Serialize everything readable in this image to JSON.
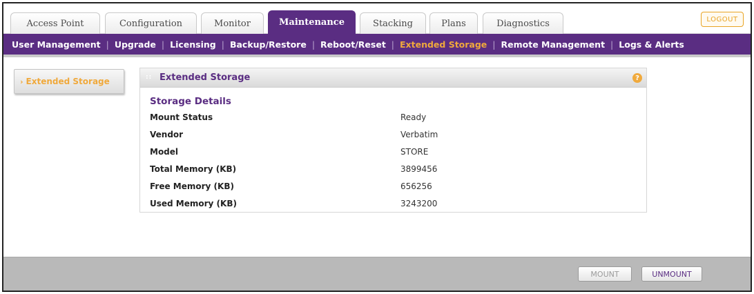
{
  "tabs": [
    "Access Point",
    "Configuration",
    "Monitor",
    "Maintenance",
    "Stacking",
    "Plans",
    "Diagnostics"
  ],
  "active_tab": "Maintenance",
  "logout_label": "LOGOUT",
  "subnav": [
    "User Management",
    "Upgrade",
    "Licensing",
    "Backup/Restore",
    "Reboot/Reset",
    "Extended Storage",
    "Remote Management",
    "Logs & Alerts"
  ],
  "active_subnav": "Extended Storage",
  "side_nav": {
    "label": "Extended Storage"
  },
  "panel": {
    "title": "Extended Storage",
    "section_title": "Storage Details",
    "rows": [
      {
        "label": "Mount Status",
        "value": "Ready"
      },
      {
        "label": "Vendor",
        "value": "Verbatim"
      },
      {
        "label": "Model",
        "value": "STORE"
      },
      {
        "label": "Total Memory (KB)",
        "value": "3899456"
      },
      {
        "label": "Free Memory (KB)",
        "value": "656256"
      },
      {
        "label": "Used Memory (KB)",
        "value": "3243200"
      }
    ]
  },
  "buttons": {
    "mount": "MOUNT",
    "unmount": "UNMOUNT"
  },
  "colors": {
    "brand_purple": "#5a2d82",
    "accent_orange": "#f0a93c",
    "bottom_bar": "#b9b9b9"
  }
}
